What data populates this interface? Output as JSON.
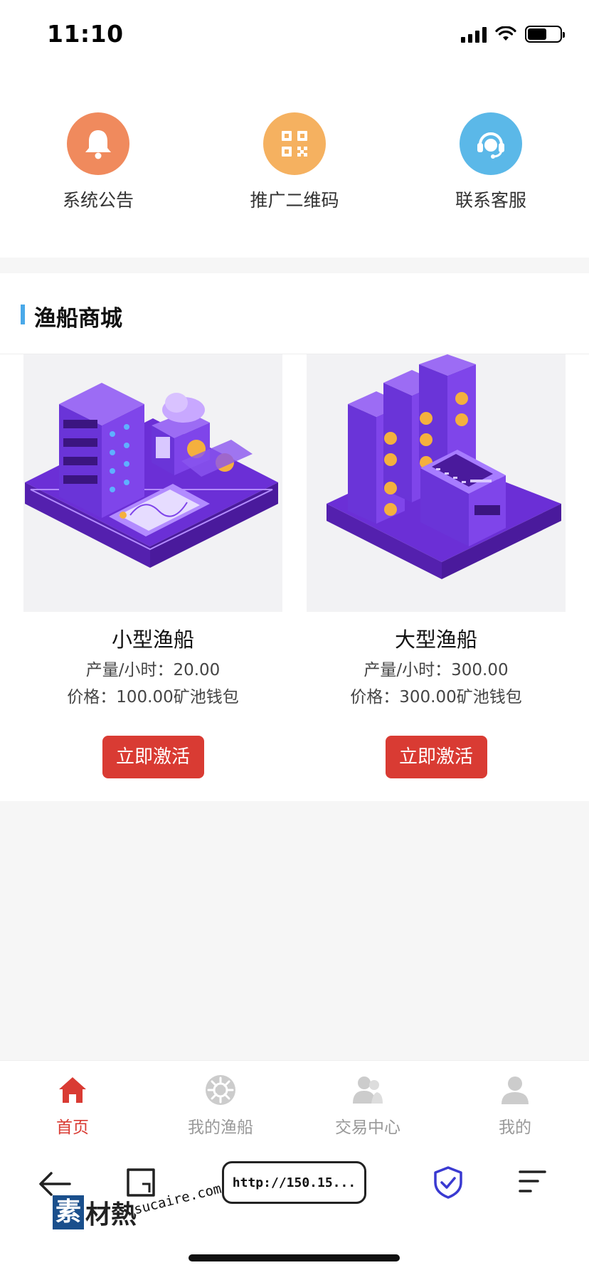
{
  "status_bar": {
    "time": "11:10"
  },
  "quick_links": [
    {
      "label": "系统公告",
      "icon": "bell-icon",
      "color": "#f08a5d"
    },
    {
      "label": "推广二维码",
      "icon": "qr-code-icon",
      "color": "#f5b160"
    },
    {
      "label": "联系客服",
      "icon": "headset-icon",
      "color": "#5bb8e8"
    }
  ],
  "shop": {
    "title": "渔船商城"
  },
  "products": [
    {
      "name": "小型渔船",
      "output": "产量/小时：20.00",
      "price": "价格：100.00矿池钱包",
      "button": "立即激活",
      "image": "isometric-server-rack-illustration"
    },
    {
      "name": "大型渔船",
      "output": "产量/小时：300.00",
      "price": "价格：300.00矿池钱包",
      "button": "立即激活",
      "image": "isometric-mining-machines-illustration"
    }
  ],
  "tabbar": {
    "items": [
      {
        "label": "首页",
        "icon": "home-icon",
        "active": true
      },
      {
        "label": "我的渔船",
        "icon": "ship-wheel-icon",
        "active": false
      },
      {
        "label": "交易中心",
        "icon": "users-icon",
        "active": false
      },
      {
        "label": "我的",
        "icon": "user-icon",
        "active": false
      }
    ]
  },
  "browser": {
    "url": "http://150.15..."
  },
  "watermark": {
    "brand_box": "素",
    "brand_text": "材熱",
    "url": "sucaire.com"
  },
  "colors": {
    "accent_red": "#d93b33",
    "section_bar": "#4aa9e9",
    "purple": "#7b3fe4"
  }
}
